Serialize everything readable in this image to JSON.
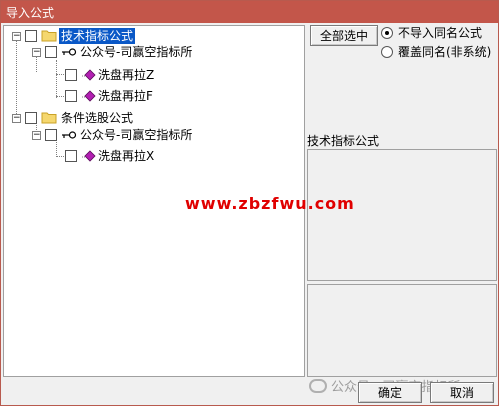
{
  "window": {
    "title": "导入公式"
  },
  "tree": {
    "groups": [
      {
        "label": "技术指标公式",
        "selected": true,
        "author": "公众号-司赢空指标所",
        "items": [
          "洗盘再拉Z",
          "洗盘再拉F"
        ]
      },
      {
        "label": "条件选股公式",
        "selected": false,
        "author": "公众号-司赢空指标所",
        "items": [
          "洗盘再拉X"
        ]
      }
    ]
  },
  "controls": {
    "select_all_label": "全部选中",
    "radio_no_import": "不导入同名公式",
    "radio_overwrite": "覆盖同名(非系统)",
    "selected_radio": "no_import"
  },
  "info": {
    "label": "技术指标公式"
  },
  "watermark": {
    "text": "www.zbzfwu.com"
  },
  "footer": {
    "ok_label": "确定",
    "cancel_label": "取消",
    "brand_mark": "公众号 · 司赢空指标所"
  },
  "colors": {
    "titlebar": "#c3564a",
    "selection": "#0a58c7",
    "watermark": "#e00000",
    "item_icon": "#b21fb2",
    "folder": "#f5d76e"
  }
}
